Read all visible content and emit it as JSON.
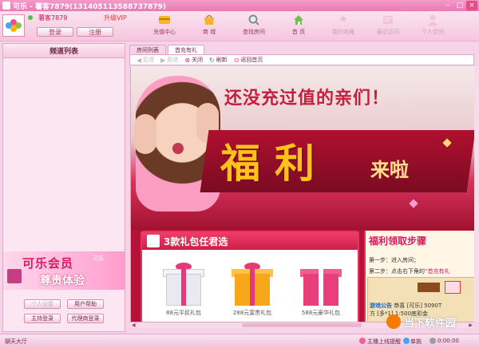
{
  "window": {
    "title": "可乐 - 薯客7879(13140511358873787​9)",
    "controls": [
      "minimize",
      "maximize",
      "close"
    ]
  },
  "user": {
    "name": "薯客7879",
    "upgrade_label": "升级VIP",
    "login_label": "登录",
    "register_label": "注册"
  },
  "toolbar": {
    "items": [
      {
        "label": "充值中心",
        "icon": "card-icon"
      },
      {
        "label": "商 城",
        "icon": "shop-icon"
      },
      {
        "label": "查找房间",
        "icon": "search-icon"
      },
      {
        "label": "首 页",
        "icon": "home-icon"
      },
      {
        "label": "我的收藏",
        "icon": "star-icon"
      },
      {
        "label": "最近访问",
        "icon": "history-icon"
      },
      {
        "label": "个人空间",
        "icon": "user-icon"
      }
    ]
  },
  "left_panel": {
    "title": "频道列表",
    "banner": {
      "line1": "可乐会员",
      "line2": "尊贵体验",
      "brand": "可乐"
    },
    "buttons": {
      "personal_settings": "个人设置",
      "user_help": "用户帮助",
      "host_login": "主持登录",
      "agent_login": "代理商登录"
    }
  },
  "tabs": [
    {
      "label": "房间列表",
      "active": false
    },
    {
      "label": "首充有礼",
      "active": true
    }
  ],
  "nav": {
    "back": "后退",
    "forward": "前进",
    "close": "关闭",
    "refresh": "刷新",
    "home": "返回首页"
  },
  "promo": {
    "headline": "还没充过值的亲们！",
    "big_text": "福利",
    "come_text": "来啦",
    "gift_section_title": "3款礼包任君选",
    "gifts": [
      {
        "label": "88元平民礼包",
        "color": "#e9e9f0"
      },
      {
        "label": "288元富贵礼包",
        "color": "#f7a81a"
      },
      {
        "label": "588元豪华礼包",
        "color": "#e83f7a"
      }
    ],
    "steps_title": "福利领取步骤",
    "step1_prefix": "第一步：进入房间；",
    "step2_prefix": "第二步：点击右下角的",
    "step2_highlight": "“首充有礼",
    "notice_label": "游戏公告",
    "notice_text": "恭喜 [可乐] 5090T",
    "notice_line2": "方 [多*1] 1:500底彩金"
  },
  "status": {
    "hall": "聊天大厅",
    "hint": "主播上线提醒",
    "mode": "单挑",
    "time": "0:00:00"
  },
  "watermark": {
    "text": "当下软件园"
  },
  "colors": {
    "accent": "#e97ab5",
    "brand_red": "#d81b60",
    "gold": "#ffc21a"
  }
}
